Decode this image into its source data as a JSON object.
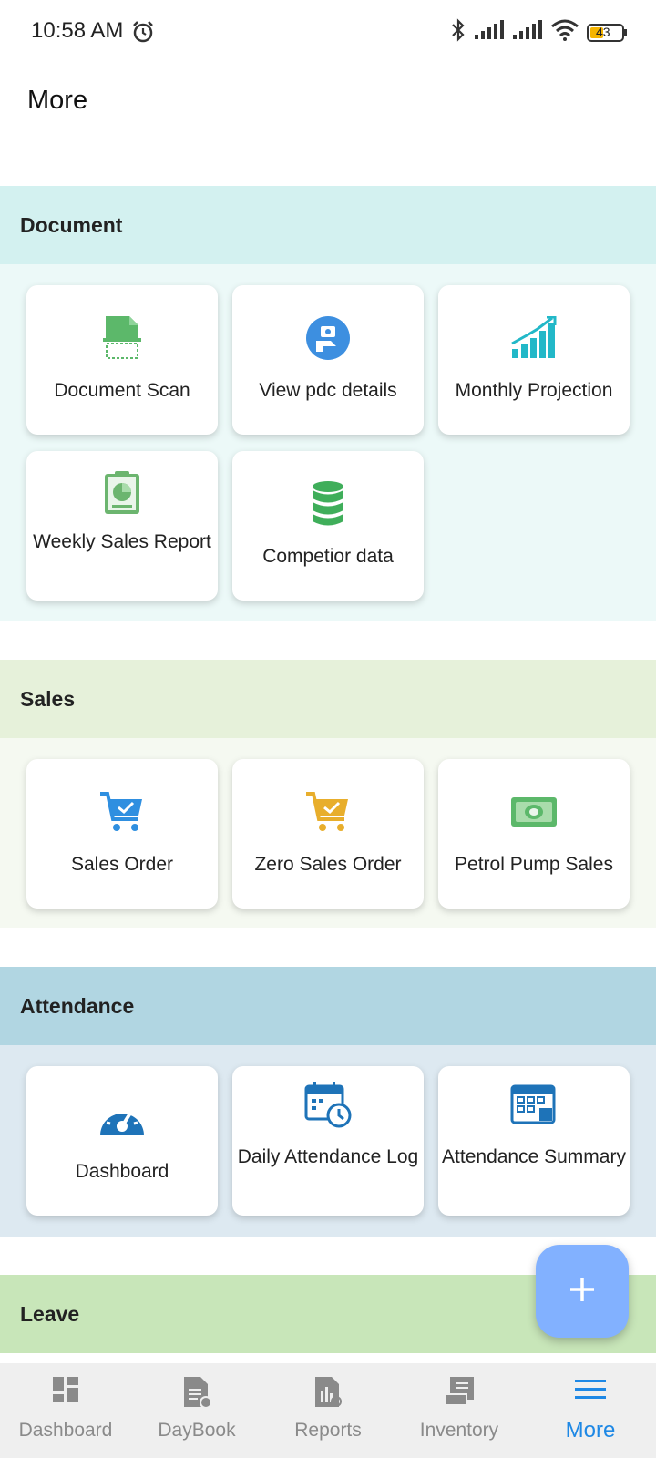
{
  "status_bar": {
    "time": "10:58 AM",
    "battery": "43"
  },
  "page": {
    "title": "More"
  },
  "sections": [
    {
      "title": "Document",
      "header_color": "#d3f1f0",
      "body_color": "#ecf9f8",
      "tiles": [
        {
          "label": "Document Scan",
          "icon": "document-scan-icon"
        },
        {
          "label": "View pdc details",
          "icon": "pdc-details-icon"
        },
        {
          "label": "Monthly Projection",
          "icon": "projection-chart-icon"
        },
        {
          "label": "Weekly Sales Report",
          "icon": "sales-report-icon"
        },
        {
          "label": "Competior data",
          "icon": "database-icon"
        }
      ]
    },
    {
      "title": "Sales",
      "header_color": "#e6f1da",
      "body_color": "#f5f9f1",
      "tiles": [
        {
          "label": "Sales Order",
          "icon": "cart-blue-icon"
        },
        {
          "label": "Zero Sales Order",
          "icon": "cart-yellow-icon"
        },
        {
          "label": "Petrol Pump Sales",
          "icon": "cash-icon"
        }
      ]
    },
    {
      "title": "Attendance",
      "header_color": "#b1d6e2",
      "body_color": "#dde9f1",
      "tiles": [
        {
          "label": "Dashboard",
          "icon": "speedometer-icon"
        },
        {
          "label": "Daily Attendance Log",
          "icon": "calendar-clock-icon"
        },
        {
          "label": "Attendance Summary",
          "icon": "calendar-summary-icon"
        }
      ]
    },
    {
      "title": "Leave",
      "header_color": "#c8e6b9"
    }
  ],
  "fab": {
    "icon": "plus-icon"
  },
  "bottom_nav": [
    {
      "label": "Dashboard",
      "icon": "dashboard-icon"
    },
    {
      "label": "DayBook",
      "icon": "daybook-icon"
    },
    {
      "label": "Reports",
      "icon": "reports-icon"
    },
    {
      "label": "Inventory",
      "icon": "inventory-icon"
    },
    {
      "label": "More",
      "icon": "menu-icon",
      "active": true
    }
  ]
}
